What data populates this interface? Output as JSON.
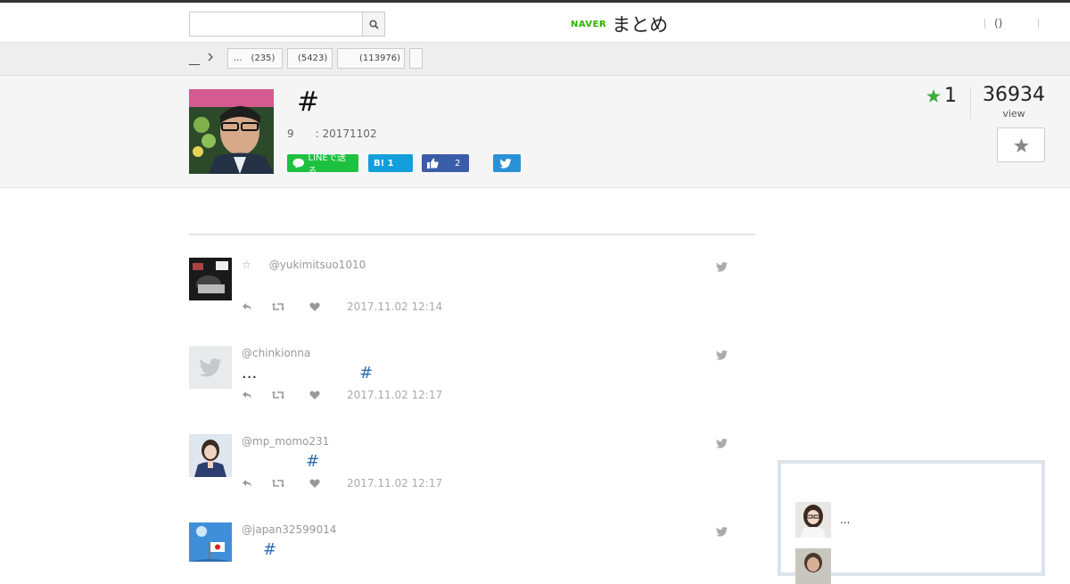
{
  "header": {
    "search": {
      "value": "",
      "placeholder": ""
    },
    "logo": {
      "brand": "NAVER",
      "name": "まとめ"
    },
    "user_link": "()"
  },
  "breadcrumb": {
    "home": "__",
    "tags": [
      {
        "label": "...",
        "count": "(235)"
      },
      {
        "label": "",
        "count": "(5423)"
      },
      {
        "label": "",
        "count": "(113976)"
      },
      {
        "label": "",
        "count": ""
      }
    ]
  },
  "matome": {
    "title": "#",
    "meta": {
      "count": "9",
      "date": ": 20171102"
    },
    "share": {
      "line": "LINEで送る",
      "hatena": "B! 1",
      "facebook": "2",
      "twitter": ""
    },
    "fav_count": "1",
    "views": "36934",
    "views_label": "view"
  },
  "tweets": [
    {
      "name": "☆",
      "handle": "@yukimitsuo1010",
      "text": "",
      "hashtag": "",
      "date": "2017.11.02 12:14"
    },
    {
      "name": "",
      "handle": "@chinkionna",
      "text": "...",
      "hashtag": "#",
      "date": "2017.11.02 12:17"
    },
    {
      "name": "",
      "handle": "@mp_momo231",
      "text": "",
      "hashtag": "#",
      "date": "2017.11.02 12:17"
    },
    {
      "name": "",
      "handle": "@japan32599014",
      "text": "",
      "hashtag": "#",
      "date": ""
    }
  ],
  "sidebar": {
    "items": [
      {
        "text": "..."
      },
      {
        "text": ""
      }
    ]
  },
  "colors": {
    "naver_green": "#2db400",
    "line_green": "#1dc13f",
    "hatena_blue": "#129fdc",
    "facebook_blue": "#3b5ca8",
    "twitter_blue": "#2b91d6",
    "hashtag_blue": "#2d6db5",
    "fav_star": "#3cab3c"
  }
}
